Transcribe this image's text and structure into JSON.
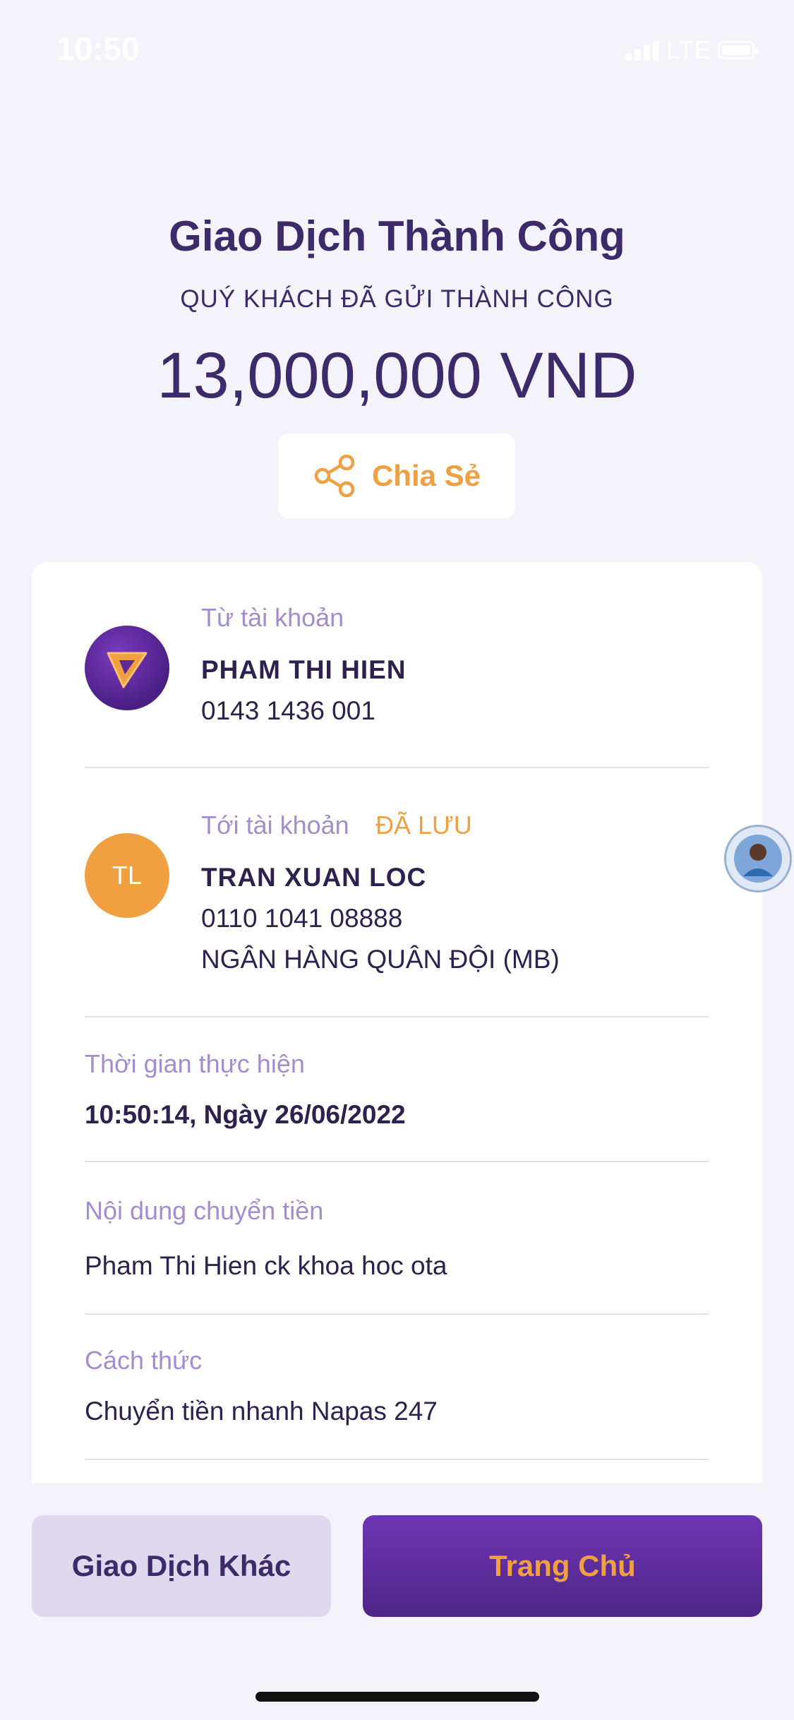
{
  "status_bar": {
    "time": "10:50",
    "network": "LTE"
  },
  "header": {
    "title": "Giao Dịch Thành Công",
    "subtitle": "QUÝ KHÁCH ĐÃ GỬI THÀNH CÔNG",
    "amount": "13,000,000 VND"
  },
  "share": {
    "label": "Chia Sẻ",
    "icon": "share-icon"
  },
  "from_account": {
    "label": "Từ tài khoản",
    "name": "PHAM THI HIEN",
    "number": "0143 1436 001",
    "icon": "bank-logo-icon"
  },
  "to_account": {
    "label": "Tới tài khoản",
    "saved_tag": "ĐÃ LƯU",
    "initials": "TL",
    "name": "TRAN XUAN LOC",
    "number": "0110 1041 08888",
    "bank": "NGÂN HÀNG QUÂN ĐỘI (MB)"
  },
  "time_row": {
    "label": "Thời gian thực hiện",
    "value": "10:50:14, Ngày 26/06/2022"
  },
  "content_row": {
    "label": "Nội dung chuyển tiền",
    "value": "Pham Thi Hien ck khoa hoc ota"
  },
  "method_row": {
    "label": "Cách thức",
    "value": "Chuyển tiền nhanh Napas 247"
  },
  "actions": {
    "other_transaction": "Giao Dịch Khác",
    "home": "Trang Chủ"
  },
  "colors": {
    "accent": "#f0a040",
    "primary": "#3d2a6a",
    "muted_label": "#a48ccf",
    "background": "#f4f3fb"
  }
}
